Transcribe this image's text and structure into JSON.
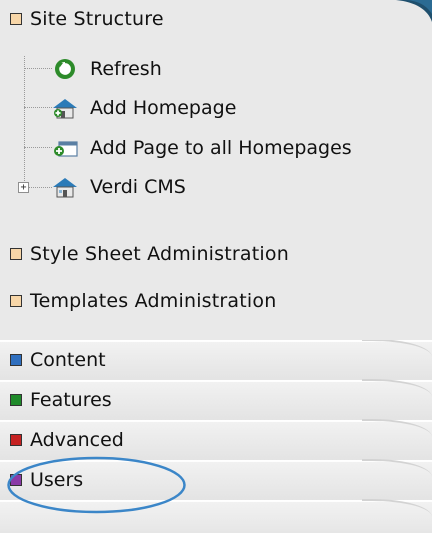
{
  "colors": {
    "bg": "#e9e9e9",
    "site_structure": "#f7d6a8",
    "content": "#2f6fbf",
    "features": "#1f8a2a",
    "advanced": "#c62222",
    "users": "#8a3aa6",
    "highlight_ellipse": "#3b86c8",
    "corner": "#1f4f6d"
  },
  "site_structure": {
    "title": "Site Structure",
    "items": [
      {
        "label": "Refresh",
        "icon": "refresh-icon"
      },
      {
        "label": "Add Homepage",
        "icon": "house-add-icon"
      },
      {
        "label": "Add Page to all Homepages",
        "icon": "page-add-icon"
      },
      {
        "label": "Verdi CMS",
        "icon": "house-icon",
        "expander": "+"
      }
    ]
  },
  "style_sheet_admin": {
    "title": "Style Sheet Administration"
  },
  "templates_admin": {
    "title": "Templates Administration"
  },
  "tabs": [
    {
      "label": "Content"
    },
    {
      "label": "Features"
    },
    {
      "label": "Advanced"
    },
    {
      "label": "Users"
    }
  ]
}
